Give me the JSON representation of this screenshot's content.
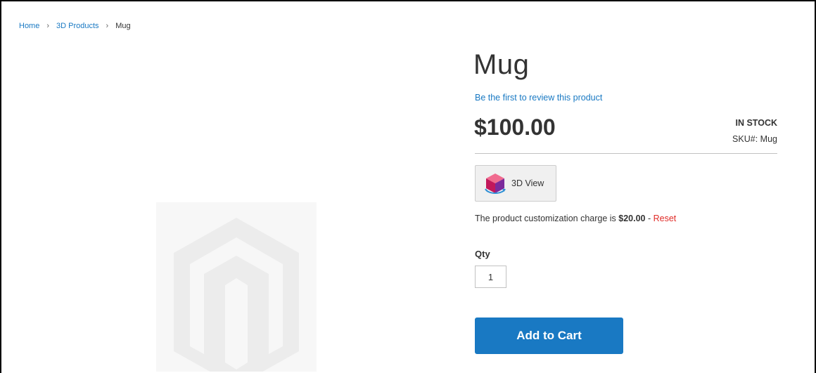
{
  "breadcrumb": {
    "home": "Home",
    "category": "3D Products",
    "current": "Mug",
    "separator": "›"
  },
  "product": {
    "title": "Mug",
    "review_link": "Be the first to review this product",
    "price": "$100.00",
    "stock_status": "IN STOCK",
    "sku_label": "SKU#:",
    "sku_value": "Mug",
    "view3d_label": "3D View",
    "customization_text": "The product customization charge is ",
    "customization_amount": "$20.00",
    "customization_sep": " - ",
    "reset_label": "Reset",
    "qty_label": "Qty",
    "qty_value": "1",
    "add_to_cart_label": "Add to Cart"
  },
  "colors": {
    "accent": "#1979c3",
    "reset": "#e02b27",
    "placeholder_bg": "#f7f7f7",
    "placeholder_logo": "#ececec"
  },
  "icons": {
    "placeholder": "magento-logo-icon",
    "view3d": "cube-3d-icon",
    "separator": "chevron-right-icon"
  }
}
